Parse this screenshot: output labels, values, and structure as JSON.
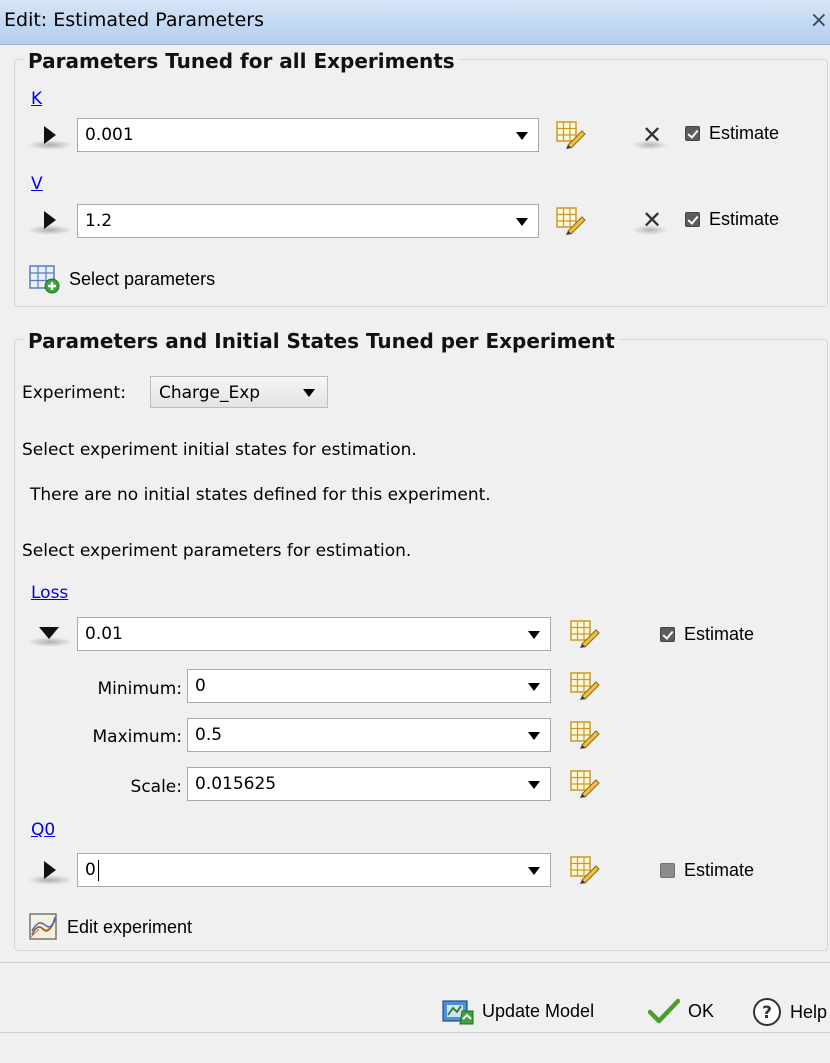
{
  "window": {
    "title": "Edit: Estimated Parameters",
    "close_glyph": "×"
  },
  "group_all": {
    "title": "Parameters Tuned for all Experiments",
    "params": [
      {
        "name": "K",
        "value": "0.001",
        "estimate_label": "Estimate",
        "estimate_checked": true,
        "icons": [
          "expand-right-icon",
          "edit-table-icon",
          "clear-icon"
        ]
      },
      {
        "name": "V",
        "value": "1.2",
        "estimate_label": "Estimate",
        "estimate_checked": true,
        "icons": [
          "expand-right-icon",
          "edit-table-icon",
          "clear-icon"
        ]
      }
    ],
    "select_parameters_label": "Select parameters"
  },
  "group_per": {
    "title": "Parameters and Initial States Tuned per Experiment",
    "experiment_label": "Experiment:",
    "experiment_value": "Charge_Exp",
    "initial_states_label": "Select experiment initial states for estimation.",
    "no_initial_states": "There are no initial states defined for this experiment.",
    "params_label": "Select experiment parameters for estimation.",
    "loss": {
      "name": "Loss",
      "value": "0.01",
      "estimate_label": "Estimate",
      "estimate_checked": true,
      "minimum_label": "Minimum:",
      "minimum_value": "0",
      "maximum_label": "Maximum:",
      "maximum_value": "0.5",
      "scale_label": "Scale:",
      "scale_value": "0.015625"
    },
    "q0": {
      "name": "Q0",
      "value": "0",
      "estimate_label": "Estimate",
      "estimate_checked": false
    },
    "edit_experiment_label": "Edit experiment"
  },
  "footer": {
    "update_model_label": "Update Model",
    "ok_label": "OK",
    "help_label": "Help"
  },
  "colors": {
    "link": "#0000ee",
    "titlebar": "#c3d9f3",
    "background": "#f0f0f0"
  }
}
